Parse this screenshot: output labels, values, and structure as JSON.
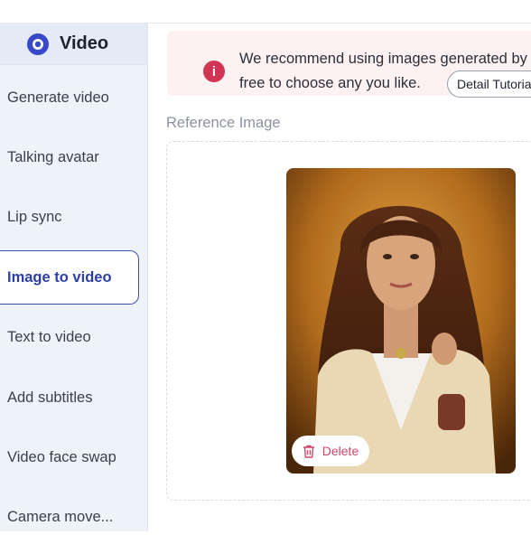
{
  "sidebar": {
    "header": {
      "title": "Video",
      "icon": "video-play-icon"
    },
    "items": [
      {
        "label": "Generate video",
        "active": false
      },
      {
        "label": "Talking avatar",
        "active": false
      },
      {
        "label": "Lip sync",
        "active": false
      },
      {
        "label": "Image to video",
        "active": true
      },
      {
        "label": "Text to video",
        "active": false
      },
      {
        "label": "Add subtitles",
        "active": false
      },
      {
        "label": "Video face swap",
        "active": false
      },
      {
        "label": "Camera move...",
        "active": false
      }
    ]
  },
  "alert": {
    "icon": "info-icon",
    "line1": "We recommend using images generated by",
    "line2": "free to choose any you like.",
    "tutorial_label": "Detail Tutorial"
  },
  "reference": {
    "label": "Reference Image",
    "delete_label": "Delete"
  },
  "colors": {
    "accent": "#2e3ea8",
    "alert_bg": "#fdf1f1",
    "alert_icon": "#d23454",
    "delete": "#d0476a",
    "sidebar_bg": "#eef2f9"
  }
}
